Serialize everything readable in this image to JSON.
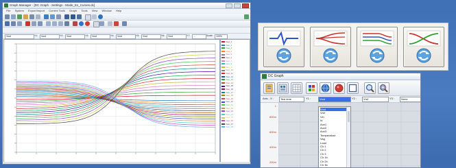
{
  "main_window": {
    "title": "Graph Manager - [DC Graph - Settings - Mode_Ex_Curves.dc]",
    "menu": [
      "File",
      "System",
      "Export/Import",
      "Current Tools",
      "Graph",
      "Tools",
      "View",
      "Window",
      "Help"
    ],
    "selectors": {
      "axis_x": "Vout",
      "y1": "Vout",
      "y2": "Vout",
      "y3": "Vout",
      "y4": "Vout",
      "y5": "Vout",
      "y6": "Vout",
      "y7": "...",
      "zoom": "100%"
    },
    "selector_labels": {
      "y1": "Y1:",
      "y2": "Y2:",
      "y3": "Y3:",
      "y4": "Y4:",
      "y5": "Y5:",
      "y6": "Y6:",
      "y7": "Y7:",
      "zoom": "Scale:"
    },
    "legend_items": [
      "Vout_1",
      "Vout_2",
      "Vout_3",
      "Vout_4",
      "Vout_5",
      "Vout_6",
      "Vout_7",
      "Vout_8",
      "Vout_9",
      "Vout_10",
      "Vout_11",
      "Vout_12",
      "Vout_13",
      "Vout_14",
      "Vout_15",
      "Vout_16",
      "Vout_17",
      "Vout_18",
      "Vout_19",
      "Vout_20",
      "Vout_21",
      "Vout_22",
      "Vout_23",
      "Vout_24",
      "Vout_25",
      "Vout_26",
      "Vout_27",
      "Vout_28"
    ],
    "legend_colors": [
      "#e0001b",
      "#1f77b4",
      "#2ca02c",
      "#ff7f0e",
      "#9467bd",
      "#8c564b",
      "#e377c2",
      "#17becf",
      "#bcbd22",
      "#7f7f7f",
      "#d62728",
      "#0055aa",
      "#00aa55",
      "#aa5500",
      "#5500aa",
      "#aa0055",
      "#008888",
      "#888800",
      "#cc4444",
      "#4444cc",
      "#44cc44",
      "#cc8844",
      "#8844cc",
      "#44cccc",
      "#cccc44",
      "#cc44cc",
      "#444444",
      "#66aaee"
    ]
  },
  "icon_panel": {
    "icons": [
      "sweep-graph-icon",
      "dc-transfer-graph-icon",
      "bus-graph-icon",
      "crossover-graph-icon"
    ]
  },
  "dc_window": {
    "title": "DC Graph",
    "selector": {
      "axis_label": "Axis - X :",
      "axis_value": "Test time",
      "y1_label": "Y1 :",
      "y1_value": "Vout",
      "y2_label": "Y2 :",
      "y2_value": "Vref",
      "y3_label": "Y3 :",
      "y3_value": "None"
    },
    "y_ticks": [
      "1",
      "800m",
      "600m",
      "400m",
      "200m"
    ],
    "dropdown_options": [
      "Vout",
      "Vref",
      "Vin",
      "Id",
      "Aux1",
      "Aux2",
      "Aux3",
      "Temperature",
      "Vag",
      "Load",
      "Ch 1",
      "Ch 2",
      "Ch 3",
      "Ch 1b",
      "Ch 2b",
      "Ch 3b"
    ],
    "dropdown_selected": "Vout"
  },
  "chart_data": {
    "type": "line",
    "x": [
      0,
      0.1,
      0.2,
      0.3,
      0.4,
      0.5,
      0.6,
      0.7,
      0.8,
      0.9,
      1.0
    ],
    "xlim": [
      0,
      1
    ],
    "ylim": [
      -1,
      1
    ],
    "xlabel": "Vout(V)",
    "ylabel": "Vout",
    "grid": true,
    "series_count": 28
  }
}
